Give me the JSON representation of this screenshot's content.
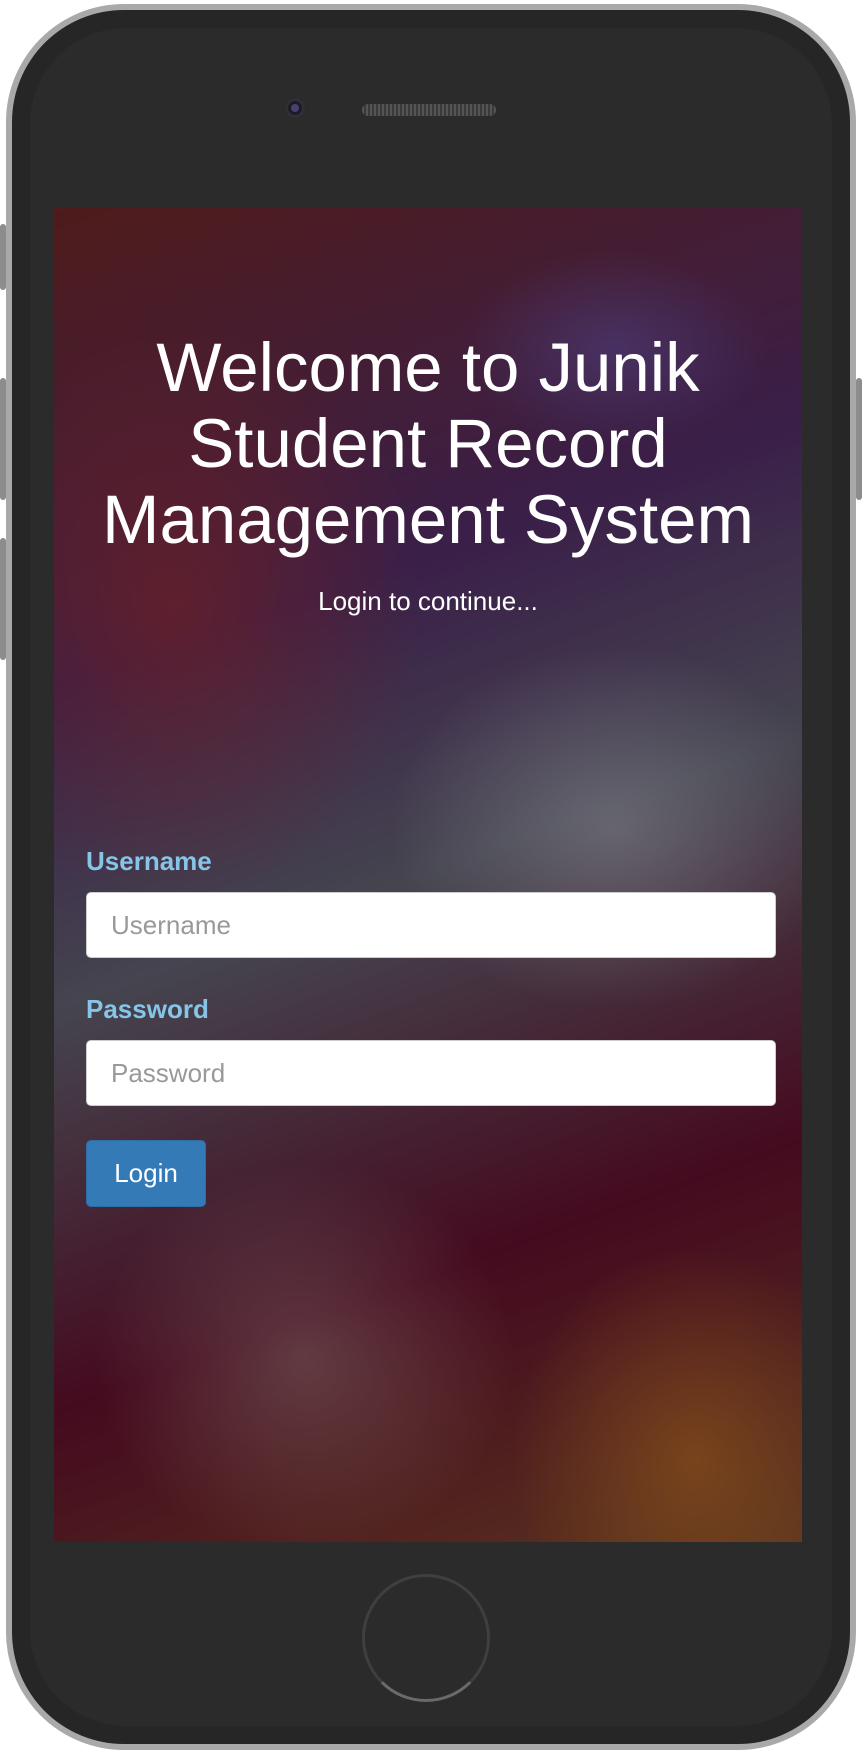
{
  "app": {
    "title": "Welcome to Junik Student Record Management System",
    "subtitle": "Login to continue..."
  },
  "form": {
    "username": {
      "label": "Username",
      "placeholder": "Username",
      "value": ""
    },
    "password": {
      "label": "Password",
      "placeholder": "Password",
      "value": ""
    },
    "login_label": "Login"
  },
  "colors": {
    "label": "#86c5e8",
    "button": "#337ab7",
    "title_text": "#ffffff",
    "phone_frame": "#262626"
  }
}
